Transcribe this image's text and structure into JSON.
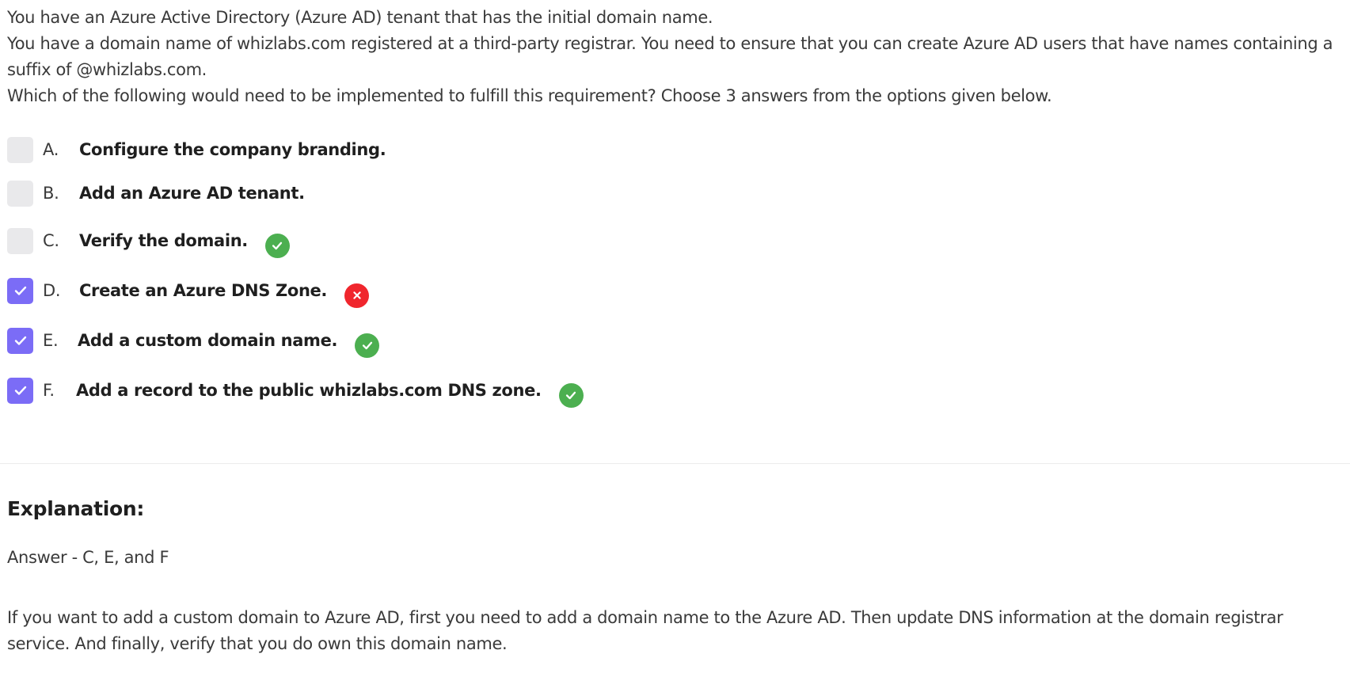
{
  "question": {
    "line1": "You have an Azure Active Directory (Azure AD) tenant that has the initial domain name.",
    "line2": "You have a domain name of whizlabs.com registered at a third-party registrar. You need to ensure that you can create Azure AD users that have names containing a suffix of @whizlabs.com.",
    "line3": "Which of the following would need to be implemented to fulfill this requirement? Choose 3 answers from the options given below."
  },
  "options": [
    {
      "letter": "A.",
      "text": "Configure the company branding.",
      "checked": false,
      "result": "none"
    },
    {
      "letter": "B.",
      "text": "Add an Azure AD tenant.",
      "checked": false,
      "result": "none"
    },
    {
      "letter": "C.",
      "text": "Verify the domain.",
      "checked": false,
      "result": "correct"
    },
    {
      "letter": "D.",
      "text": "Create an Azure DNS Zone.",
      "checked": true,
      "result": "wrong"
    },
    {
      "letter": "E.",
      "text": "Add a custom domain name.",
      "checked": true,
      "result": "correct"
    },
    {
      "letter": "F.",
      "text": "Add a record to the public whizlabs.com DNS zone.",
      "checked": true,
      "result": "correct"
    }
  ],
  "explanation": {
    "title": "Explanation:",
    "answer": "Answer - C, E, and F",
    "body": "If you want to add a custom domain to Azure AD, first you need to add a domain name to the Azure AD. Then update DNS information at the domain registrar service. And finally, verify that you do own this domain name."
  },
  "colors": {
    "checkbox_checked": "#7b6cf6",
    "checkbox_unchecked": "#e9e9eb",
    "correct": "#4caf50",
    "wrong": "#f0262d"
  },
  "icons": {
    "checked": "checkmark-icon",
    "correct": "correct-check-icon",
    "wrong": "wrong-x-icon"
  }
}
